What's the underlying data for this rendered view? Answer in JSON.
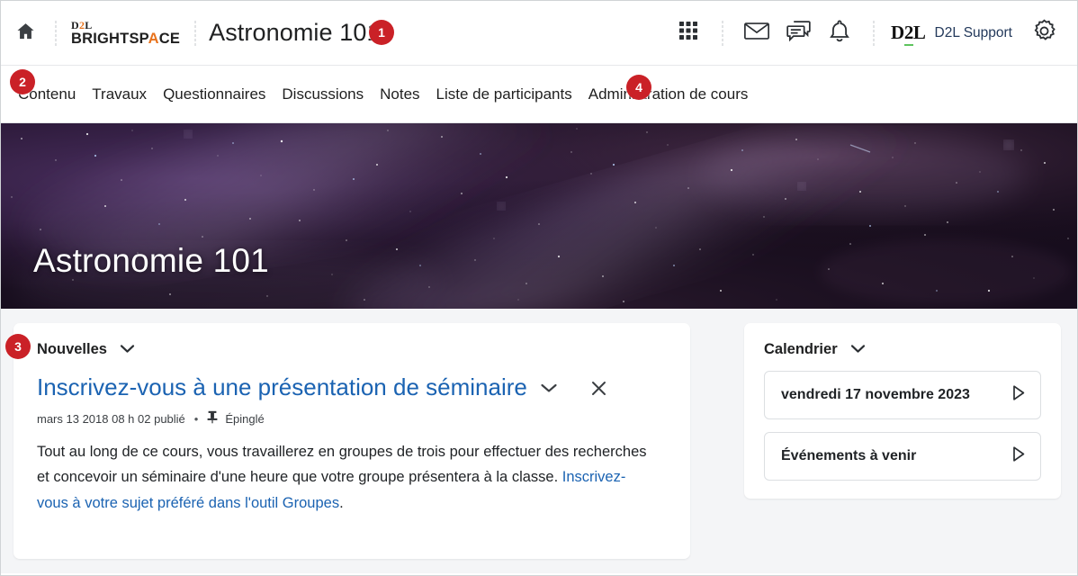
{
  "header": {
    "home_icon": "home-icon",
    "brand": {
      "top": "D2L",
      "top_accent": "2",
      "word_before": "BRIGHTSP",
      "word_accent": "A",
      "word_after": "CE"
    },
    "course_title": "Astronomie 101",
    "icons": [
      {
        "name": "course-selector-icon",
        "label": "Sélecteur de cours"
      },
      {
        "name": "email-icon",
        "label": "Courriel"
      },
      {
        "name": "subscription-alerts-icon",
        "label": "Alertes d'abonnement"
      },
      {
        "name": "update-alerts-icon",
        "label": "Alertes de mise à jour"
      }
    ],
    "support_logo": "D2L",
    "support_text": "D2L Support",
    "settings_icon": "gear-icon"
  },
  "nav": {
    "items": [
      {
        "label": "Contenu"
      },
      {
        "label": "Travaux"
      },
      {
        "label": "Questionnaires"
      },
      {
        "label": "Discussions"
      },
      {
        "label": "Notes"
      },
      {
        "label": "Liste de participants"
      },
      {
        "label": "Administration de cours"
      }
    ]
  },
  "hero": {
    "title": "Astronomie 101"
  },
  "news": {
    "widget_title": "Nouvelles",
    "announcement": {
      "title": "Inscrivez-vous à une présentation de séminaire",
      "meta_date": "mars 13 2018 08 h 02 publié",
      "meta_separator": "•",
      "pinned_label": "Épinglé",
      "body_part1": "Tout au long de ce cours, vous travaillerez en groupes de trois pour effectuer des recherches et concevoir un séminaire d'une heure que votre groupe présentera à la classe. ",
      "body_link": "Inscrivez-vous à votre sujet préféré dans l'outil Groupes",
      "body_part2": "."
    }
  },
  "calendar": {
    "widget_title": "Calendrier",
    "items": [
      {
        "label": "vendredi 17 novembre 2023"
      },
      {
        "label": "Événements à venir"
      }
    ]
  },
  "callouts": [
    {
      "number": "1"
    },
    {
      "number": "2"
    },
    {
      "number": "3"
    },
    {
      "number": "4"
    }
  ],
  "colors": {
    "badge_red": "#ca2127",
    "link_blue": "#1b63b2",
    "brand_orange": "#e8731d",
    "page_bg": "#f4f5f7"
  }
}
